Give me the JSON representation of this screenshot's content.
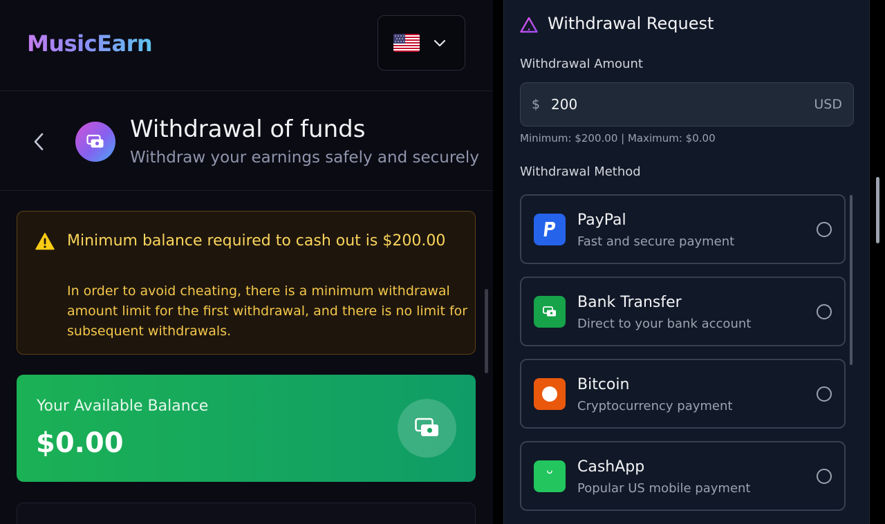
{
  "header": {
    "logo_text": "MusicEarn",
    "language_flag": "us-flag-icon"
  },
  "page": {
    "title": "Withdrawal of funds",
    "subtitle": "Withdraw your earnings safely and securely"
  },
  "warning": {
    "title": "Minimum balance required to cash out is $200.00",
    "body": "In order to avoid cheating, there is a minimum withdrawal amount limit for the first withdrawal, and there is no limit for subsequent withdrawals."
  },
  "balance": {
    "label": "Your Available Balance",
    "value": "$0.00"
  },
  "withdrawal_form": {
    "title": "Withdrawal Request",
    "amount_label": "Withdrawal Amount",
    "currency_symbol": "$",
    "amount_value": "200",
    "currency_code": "USD",
    "limits_text": "Minimum: $200.00 | Maximum: $0.00",
    "method_label": "Withdrawal Method",
    "methods": [
      {
        "name": "PayPal",
        "description": "Fast and secure payment",
        "icon": "paypal-icon",
        "color": "#2563eb",
        "selected": false
      },
      {
        "name": "Bank Transfer",
        "description": "Direct to your bank account",
        "icon": "bank-transfer-icon",
        "color": "#16a34a",
        "selected": false
      },
      {
        "name": "Bitcoin",
        "description": "Cryptocurrency payment",
        "icon": "bitcoin-icon",
        "color": "#ea580c",
        "selected": false
      },
      {
        "name": "CashApp",
        "description": "Popular US mobile payment",
        "icon": "cashapp-icon",
        "color": "#22c55e",
        "selected": false
      }
    ]
  },
  "colors": {
    "warning_text": "#fbd55c",
    "balance_green": "#1bb155",
    "panel_bg": "#111827"
  }
}
